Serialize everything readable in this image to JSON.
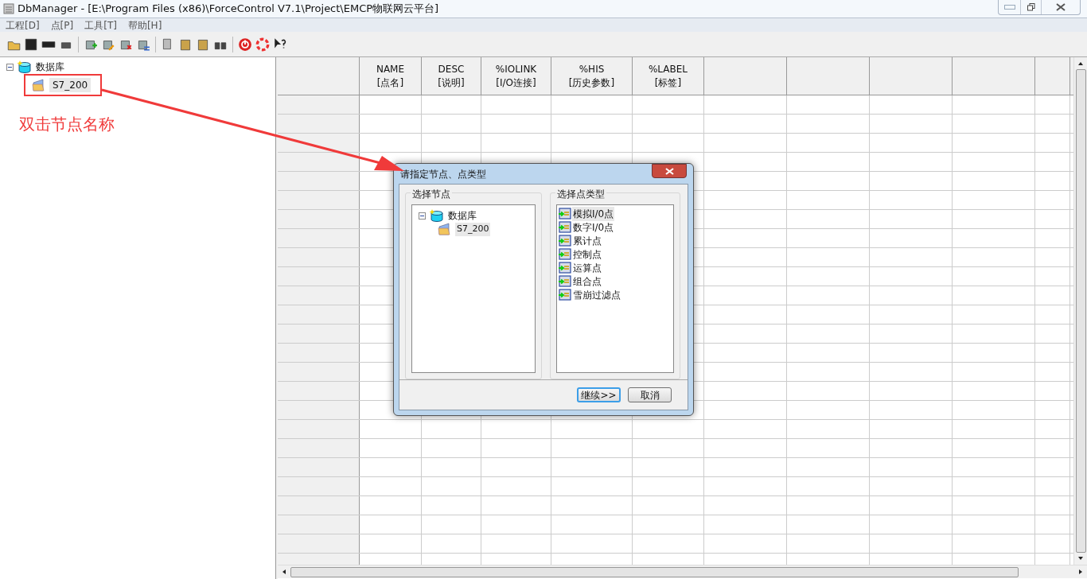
{
  "window": {
    "title": "DbManager - [E:\\Program Files (x86)\\ForceControl V7.1\\Project\\EMCP物联网云平台]"
  },
  "menu": [
    "工程[D]",
    "点[P]",
    "工具[T]",
    "帮助[H]"
  ],
  "tree": {
    "label": "数据库",
    "expanded": true,
    "children": [
      {
        "label": "S7_200",
        "selected": true
      }
    ]
  },
  "annotation": {
    "text": "双击节点名称"
  },
  "grid": {
    "columns": [
      {
        "name": "NAME",
        "sub": "[点名]"
      },
      {
        "name": "DESC",
        "sub": "[说明]"
      },
      {
        "name": "%IOLINK",
        "sub": "[I/O连接]"
      },
      {
        "name": "%HIS",
        "sub": "[历史参数]"
      },
      {
        "name": "%LABEL",
        "sub": "[标签]"
      }
    ]
  },
  "dialog": {
    "title": "请指定节点、点类型",
    "node_group": {
      "title": "选择节点",
      "tree": {
        "label": "数据库",
        "expanded": true,
        "children": [
          {
            "label": "S7_200",
            "selected": true
          }
        ]
      }
    },
    "type_group": {
      "title": "选择点类型",
      "items": [
        {
          "label": "模拟I/0点",
          "selected": true
        },
        {
          "label": "数字I/0点",
          "selected": false
        },
        {
          "label": "累计点",
          "selected": false
        },
        {
          "label": "控制点",
          "selected": false
        },
        {
          "label": "运算点",
          "selected": false
        },
        {
          "label": "组合点",
          "selected": false
        },
        {
          "label": "雪崩过滤点",
          "selected": false
        }
      ]
    },
    "buttons": [
      {
        "label": "继续>>",
        "default": true
      },
      {
        "label": "取消",
        "default": false
      }
    ]
  }
}
